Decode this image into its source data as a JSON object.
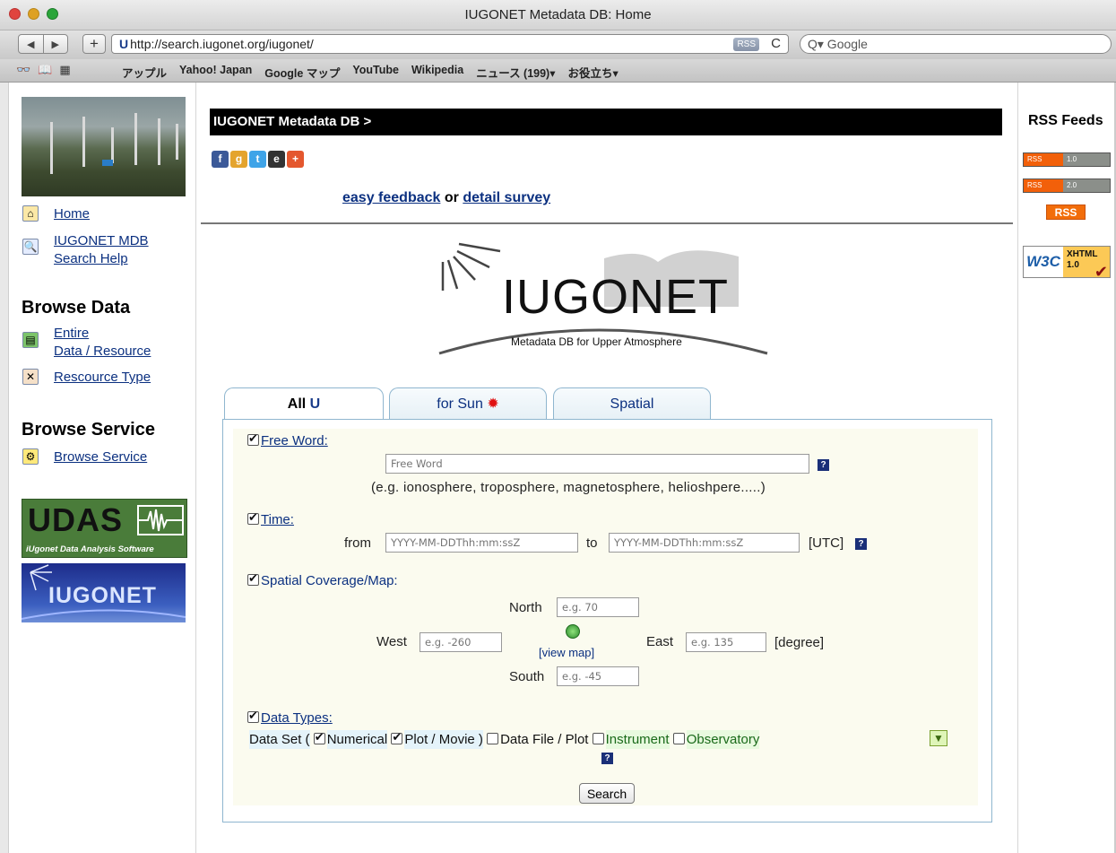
{
  "window": {
    "title": "IUGONET Metadata DB: Home"
  },
  "toolbar": {
    "back": "◀",
    "forward": "▶",
    "new_tab": "+",
    "url": "http://search.iugonet.org/iugonet/",
    "rss_chip": "RSS",
    "reload": "C",
    "search_placeholder": "Q▾ Google"
  },
  "bookmarks": [
    "アップル",
    "Yahoo! Japan",
    "Google マップ",
    "YouTube",
    "Wikipedia",
    "ニュース (199)▾",
    "お役立ち▾"
  ],
  "sidebar": {
    "home": "Home",
    "search_help_line1": "IUGONET MDB",
    "search_help_line2": "Search Help",
    "browse_data_heading": "Browse Data",
    "entire_line1": "Entire",
    "entire_line2": "Data / Resource",
    "resource_type": "Rescource Type",
    "browse_service_heading": "Browse Service",
    "browse_service": "Browse Service",
    "udas_title": "UDAS",
    "udas_sub": "iUgonet Data Analysis Software",
    "banner_text": "IUGONET"
  },
  "main": {
    "bar_title": "IUGONET Metadata DB >",
    "feedback_link": "easy feedback",
    "feedback_or": "or",
    "survey_link": "detail survey",
    "logo_text": "IUGONET",
    "logo_sub": "Metadata DB for Upper Atmosphere"
  },
  "tabs": [
    {
      "label": "All",
      "active": true
    },
    {
      "label": "for Sun",
      "active": false
    },
    {
      "label": "Spatial",
      "active": false
    }
  ],
  "form": {
    "free_word_label": "Free Word:",
    "free_word_placeholder": "Free Word",
    "free_word_hint": "(e.g. ionosphere, troposphere, magnetosphere, helioshpere.....)",
    "time_label": "Time:",
    "from_label": "from",
    "from_placeholder": "YYYY-MM-DDThh:mm:ssZ",
    "to_label": "to",
    "to_placeholder": "YYYY-MM-DDThh:mm:ssZ",
    "utc_label": "[UTC]",
    "spatial_label": "Spatial Coverage/Map:",
    "north_label": "North",
    "north_placeholder": "e.g. 70",
    "west_label": "West",
    "west_placeholder": "e.g. -260",
    "view_map": "[view map]",
    "east_label": "East",
    "east_placeholder": "e.g. 135",
    "degree_label": "[degree]",
    "south_label": "South",
    "south_placeholder": "e.g. -45",
    "data_types_label": "Data Types:",
    "data_set_open": "Data Set (",
    "numerical": "Numerical",
    "plot_movie": "Plot / Movie )",
    "data_file_plot": "Data File / Plot",
    "instrument": "Instrument",
    "observatory": "Observatory",
    "search_button": "Search"
  },
  "right": {
    "rss_heading": "RSS Feeds",
    "rss10_left": "RSS",
    "rss10_right": "1.0",
    "rss20_left": "RSS",
    "rss20_right": "2.0",
    "rss_button": "RSS",
    "w3c_left": "W3C",
    "w3c_line1": "XHTML",
    "w3c_line2": "1.0"
  }
}
